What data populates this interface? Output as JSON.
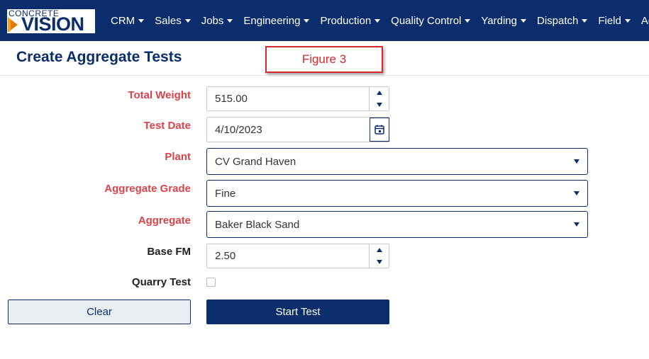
{
  "brand": {
    "logo_top": "CONCRETE",
    "logo_main": "VISION"
  },
  "nav": {
    "items": [
      {
        "label": "CRM"
      },
      {
        "label": "Sales"
      },
      {
        "label": "Jobs"
      },
      {
        "label": "Engineering"
      },
      {
        "label": "Production"
      },
      {
        "label": "Quality Control"
      },
      {
        "label": "Yarding"
      },
      {
        "label": "Dispatch"
      },
      {
        "label": "Field"
      },
      {
        "label": "Accou"
      }
    ]
  },
  "page": {
    "title": "Create Aggregate Tests",
    "figure_label": "Figure 3"
  },
  "form": {
    "total_weight": {
      "label": "Total Weight",
      "value": "515.00"
    },
    "test_date": {
      "label": "Test Date",
      "value": "4/10/2023"
    },
    "plant": {
      "label": "Plant",
      "value": "CV Grand Haven"
    },
    "aggregate_grade": {
      "label": "Aggregate Grade",
      "value": "Fine"
    },
    "aggregate": {
      "label": "Aggregate",
      "value": "Baker Black Sand"
    },
    "base_fm": {
      "label": "Base FM",
      "value": "2.50"
    },
    "quarry_test": {
      "label": "Quarry Test",
      "checked": false
    }
  },
  "buttons": {
    "clear": "Clear",
    "start": "Start Test"
  },
  "colors": {
    "navy": "#0b2d6b",
    "required_label": "#d9434a",
    "figure_red": "#d62828",
    "logo_orange": "#f5a11c"
  },
  "icons": {
    "calendar": "calendar-icon",
    "spin_up": "spin-up-icon",
    "spin_down": "spin-down-icon",
    "dropdown": "chevron-down-icon"
  }
}
